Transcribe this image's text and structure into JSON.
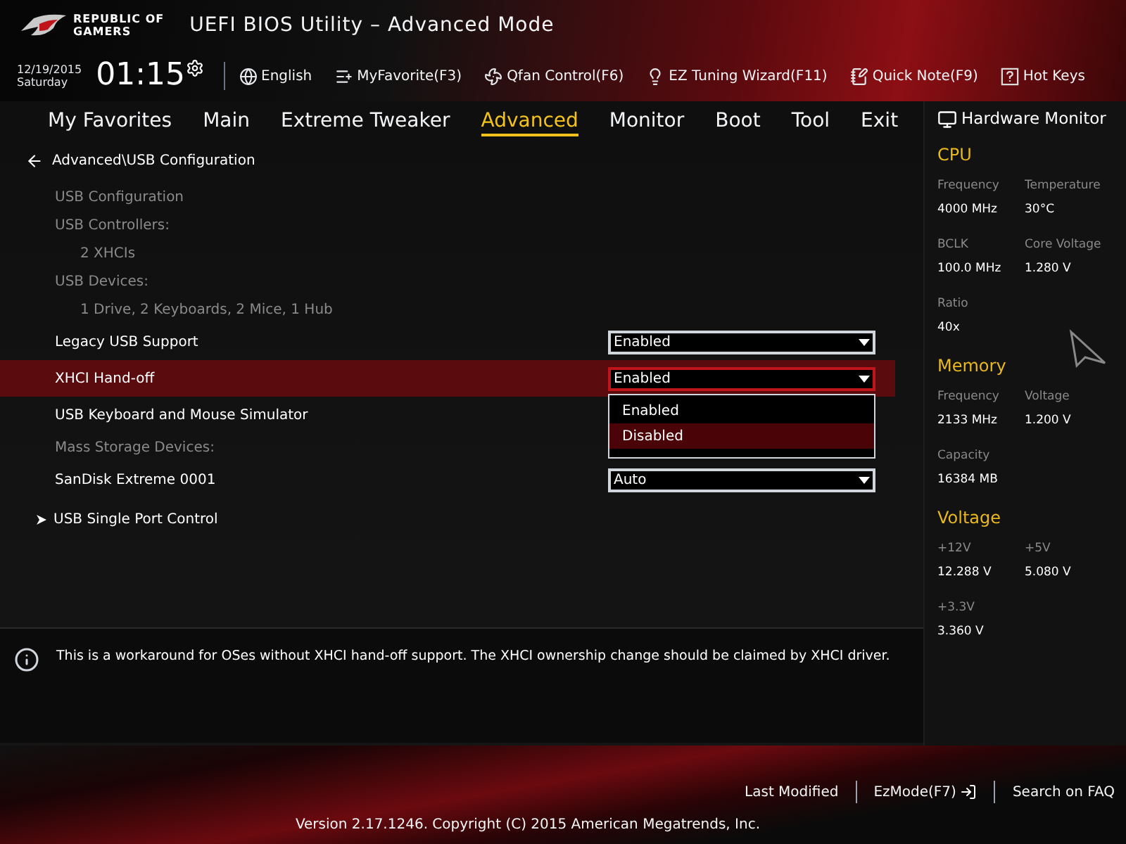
{
  "brand": {
    "logo_lines": [
      "REPUBLIC OF",
      "GAMERS"
    ],
    "title": "UEFI BIOS Utility – Advanced Mode"
  },
  "clock": {
    "date": "12/19/2015",
    "day": "Saturday",
    "time": "01:15"
  },
  "toolbar": [
    {
      "kind": "globe",
      "label": "English"
    },
    {
      "kind": "favorite",
      "label": "MyFavorite(F3)"
    },
    {
      "kind": "fan",
      "label": "Qfan Control(F6)"
    },
    {
      "kind": "bulb",
      "label": "EZ Tuning Wizard(F11)"
    },
    {
      "kind": "note",
      "label": "Quick Note(F9)"
    },
    {
      "kind": "help",
      "label": "Hot Keys"
    }
  ],
  "tabs": [
    {
      "label": "My Favorites",
      "selected": false
    },
    {
      "label": "Main",
      "selected": false
    },
    {
      "label": "Extreme Tweaker",
      "selected": false
    },
    {
      "label": "Advanced",
      "selected": true
    },
    {
      "label": "Monitor",
      "selected": false
    },
    {
      "label": "Boot",
      "selected": false
    },
    {
      "label": "Tool",
      "selected": false
    },
    {
      "label": "Exit",
      "selected": false
    }
  ],
  "breadcrumb": "Advanced\\USB Configuration",
  "items": [
    {
      "kind": "heading",
      "label": "USB Configuration"
    },
    {
      "kind": "heading",
      "label": "USB Controllers:"
    },
    {
      "kind": "info",
      "label": "2 XHCIs"
    },
    {
      "kind": "heading",
      "label": "USB Devices:"
    },
    {
      "kind": "info",
      "label": "1 Drive, 2 Keyboards, 2 Mice, 1 Hub"
    },
    {
      "kind": "setting",
      "label": "Legacy USB Support",
      "value": "Enabled",
      "selected": false
    },
    {
      "kind": "setting",
      "label": "XHCI Hand-off",
      "value": "Enabled",
      "selected": true,
      "expanded": true,
      "options": [
        {
          "label": "Enabled",
          "highlighted": false
        },
        {
          "label": "Disabled",
          "highlighted": true
        }
      ]
    },
    {
      "kind": "setting",
      "label": "USB Keyboard and Mouse Simulator",
      "selected": false
    },
    {
      "kind": "heading",
      "label": "Mass Storage Devices:"
    },
    {
      "kind": "setting",
      "label": "SanDisk Extreme 0001",
      "value": "Auto",
      "selected": false
    },
    {
      "kind": "submenu",
      "label": "USB Single Port Control"
    }
  ],
  "hardware_monitor": {
    "title": "Hardware Monitor",
    "sections": [
      {
        "title": "CPU",
        "fields": [
          {
            "label": "Frequency",
            "value": "4000 MHz"
          },
          {
            "label": "Temperature",
            "value": "30°C"
          },
          {
            "label": "BCLK",
            "value": "100.0 MHz"
          },
          {
            "label": "Core Voltage",
            "value": "1.280 V"
          },
          {
            "label": "Ratio",
            "value": "40x"
          }
        ]
      },
      {
        "title": "Memory",
        "fields": [
          {
            "label": "Frequency",
            "value": "2133 MHz"
          },
          {
            "label": "Voltage",
            "value": "1.200 V"
          },
          {
            "label": "Capacity",
            "value": "16384 MB"
          }
        ]
      },
      {
        "title": "Voltage",
        "fields": [
          {
            "label": "+12V",
            "value": "12.288 V"
          },
          {
            "label": "+5V",
            "value": "5.080 V"
          },
          {
            "label": "+3.3V",
            "value": "3.360 V"
          }
        ]
      }
    ]
  },
  "help_text": "This is a workaround for OSes without XHCI hand-off support. The XHCI ownership change should be claimed by XHCI driver.",
  "footer": {
    "actions": [
      {
        "kind": "text",
        "label": "Last Modified"
      },
      {
        "kind": "ezmode",
        "label": "EzMode(F7)"
      },
      {
        "kind": "text",
        "label": "Search on FAQ"
      }
    ],
    "version": "Version 2.17.1246. Copyright (C) 2015 American Megatrends, Inc."
  }
}
